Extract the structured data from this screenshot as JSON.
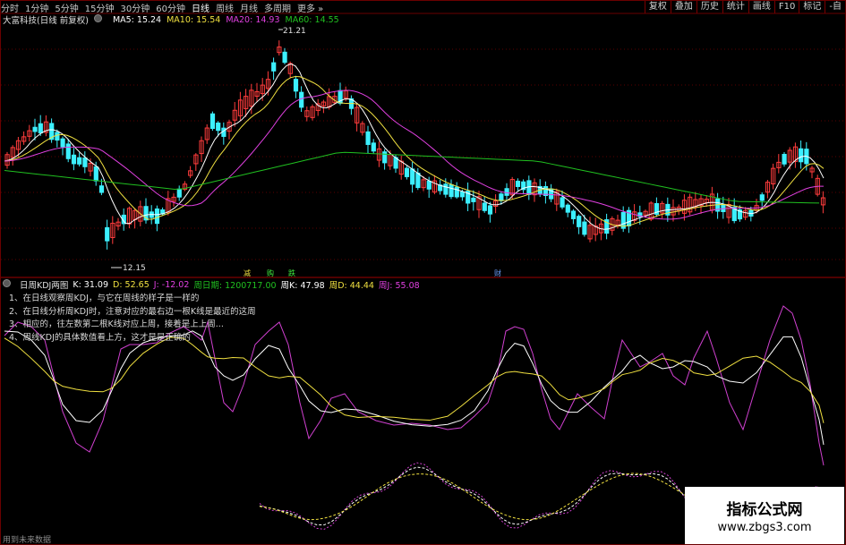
{
  "toolbar": {
    "periods": [
      "分时",
      "1分钟",
      "5分钟",
      "15分钟",
      "30分钟",
      "60分钟",
      "日线",
      "周线",
      "月线",
      "多周期",
      "更多 »"
    ],
    "active_period": "日线",
    "buttons": [
      "复权",
      "叠加",
      "历史",
      "统计",
      "画线",
      "F10",
      "标记",
      "-自"
    ]
  },
  "price_panel": {
    "stock_name": "大富科技(日线 前复权)",
    "ma5": "MA5: 15.24",
    "ma10": "MA10: 15.54",
    "ma20": "MA20: 14.93",
    "ma60": "MA60: 14.55",
    "high_label": "21.21",
    "low_label": "12.15",
    "event_labels": [
      "减",
      "购",
      "跌",
      "财"
    ]
  },
  "kdj_panel": {
    "title": "日周KDJ两图",
    "k": "K: 31.09",
    "d": "D: 52.65",
    "j": "J: -12.02",
    "week_period": "周日期: 1200717.00",
    "week_k": "周K: 47.98",
    "week_d": "周D: 44.44",
    "week_j": "周J: 55.08",
    "notes": [
      "1、在日线观察周KDJ，与它在周线的样子是一样的",
      "2、在日线分析周KDJ时，注意对应的最右边一根K线是最近的这周",
      "3、相应的，往左数第二根K线对应上周，接着是上上周...",
      "4、周线KDJ的具体数值看上方，这才是是正确的"
    ]
  },
  "footnote": "用到未来数据",
  "watermark": {
    "line1": "指标公式网",
    "line2": "www.zbgs3.com"
  },
  "colors": {
    "up": "#ff3c3c",
    "down": "#3cf0ff",
    "ma5": "#ffffff",
    "ma10": "#f0e040",
    "ma20": "#e040e0",
    "ma60": "#20c020",
    "frame": "#6a0000"
  }
}
